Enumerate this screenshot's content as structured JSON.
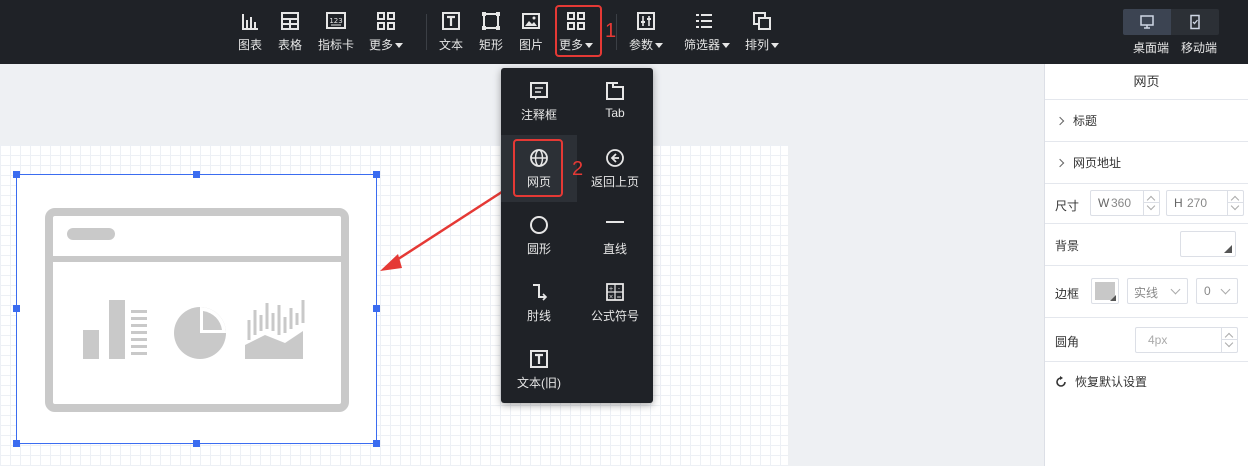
{
  "toolbar": {
    "items_left": [
      {
        "label": "图表",
        "icon": "bar-chart-icon"
      },
      {
        "label": "表格",
        "icon": "table-icon"
      },
      {
        "label": "指标卡",
        "icon": "metric-card-icon"
      },
      {
        "label": "更多",
        "icon": "grid-icon"
      }
    ],
    "items_mid": [
      {
        "label": "文本",
        "icon": "text-icon"
      },
      {
        "label": "矩形",
        "icon": "rectangle-icon"
      },
      {
        "label": "图片",
        "icon": "image-icon"
      },
      {
        "label": "更多",
        "icon": "grid-icon"
      }
    ],
    "items_right": [
      {
        "label": "参数",
        "icon": "sliders-icon"
      },
      {
        "label": "筛选器",
        "icon": "filter-list-icon"
      },
      {
        "label": "排列",
        "icon": "arrange-icon"
      }
    ],
    "annotation_1": "1",
    "device": {
      "desktop": "桌面端",
      "mobile": "移动端"
    }
  },
  "menu": {
    "items": [
      {
        "label": "注释框",
        "icon": "annotation-icon"
      },
      {
        "label": "Tab",
        "icon": "tab-icon"
      },
      {
        "label": "网页",
        "icon": "globe-icon"
      },
      {
        "label": "返回上页",
        "icon": "back-icon"
      },
      {
        "label": "圆形",
        "icon": "circle-icon"
      },
      {
        "label": "直线",
        "icon": "line-icon"
      },
      {
        "label": "肘线",
        "icon": "elbow-line-icon"
      },
      {
        "label": "公式符号",
        "icon": "formula-icon"
      },
      {
        "label": "文本(旧)",
        "icon": "text-icon"
      }
    ],
    "annotation_2": "2"
  },
  "panel": {
    "title": "网页",
    "sections": [
      "标题",
      "网页地址"
    ],
    "size": {
      "label": "尺寸",
      "w_prefix": "W",
      "w_value": "360",
      "h_prefix": "H",
      "h_value": "270"
    },
    "background": {
      "label": "背景"
    },
    "border": {
      "label": "边框",
      "style": "实线",
      "width": "0"
    },
    "radius": {
      "label": "圆角",
      "placeholder": "4px"
    },
    "reset": "恢复默认设置"
  },
  "colors": {
    "accent": "#3b6cf0",
    "highlight": "#e53935",
    "toolbar_bg": "#1f2227"
  }
}
